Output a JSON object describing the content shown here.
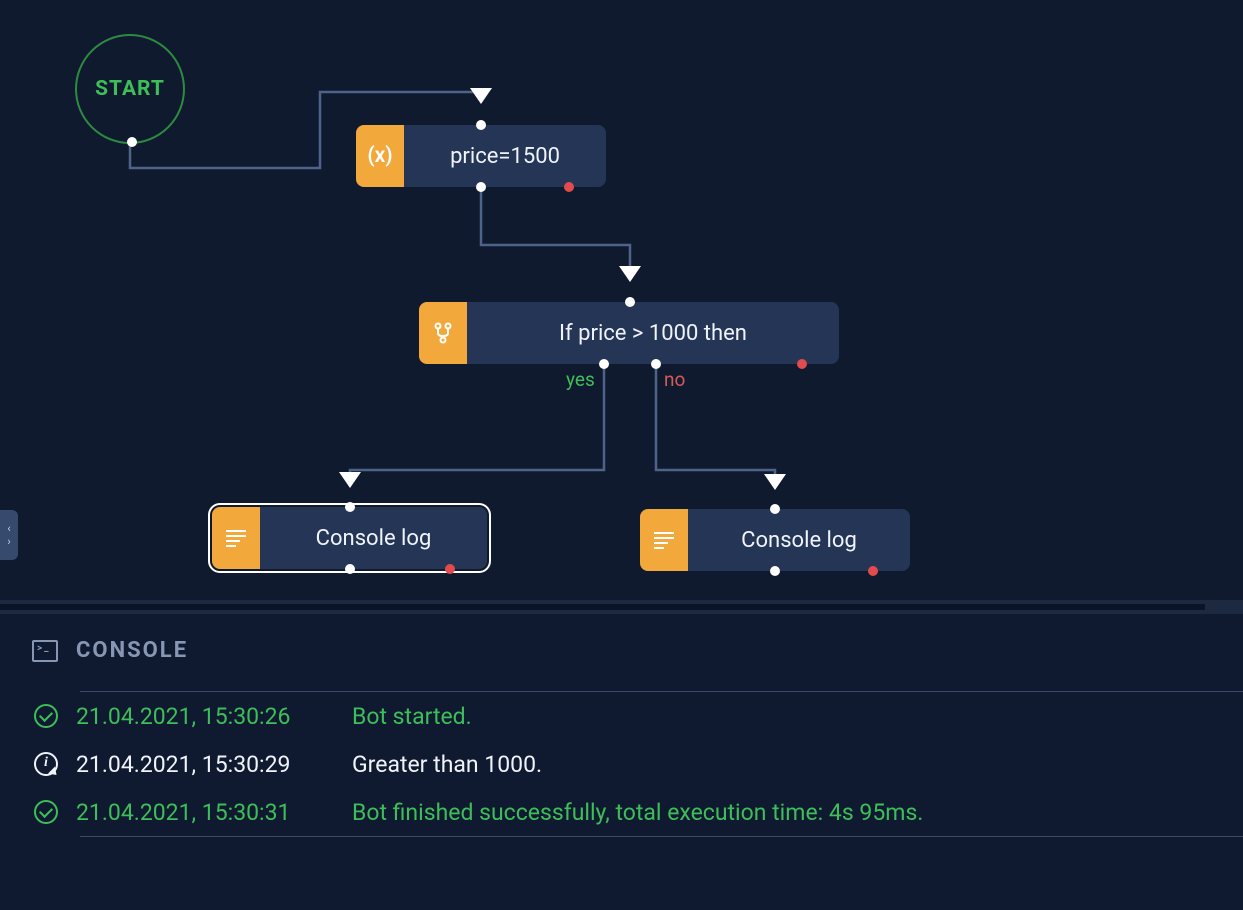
{
  "start": {
    "label": "START"
  },
  "nodes": {
    "assign": {
      "label": "price=1500",
      "icon": "variable-icon"
    },
    "condition": {
      "label": "If price > 1000 then",
      "icon": "branch-icon"
    },
    "log_yes": {
      "label": "Console log",
      "icon": "log-icon"
    },
    "log_no": {
      "label": "Console log",
      "icon": "log-icon"
    }
  },
  "branch_labels": {
    "yes": "yes",
    "no": "no"
  },
  "console": {
    "title": "CONSOLE",
    "rows": [
      {
        "status": "success",
        "ts": "21.04.2021, 15:30:26",
        "msg": "Bot started."
      },
      {
        "status": "info",
        "ts": "21.04.2021, 15:30:29",
        "msg": "Greater than 1000."
      },
      {
        "status": "success",
        "ts": "21.04.2021, 15:30:31",
        "msg": "Bot finished successfully, total execution time: 4s 95ms."
      }
    ]
  }
}
